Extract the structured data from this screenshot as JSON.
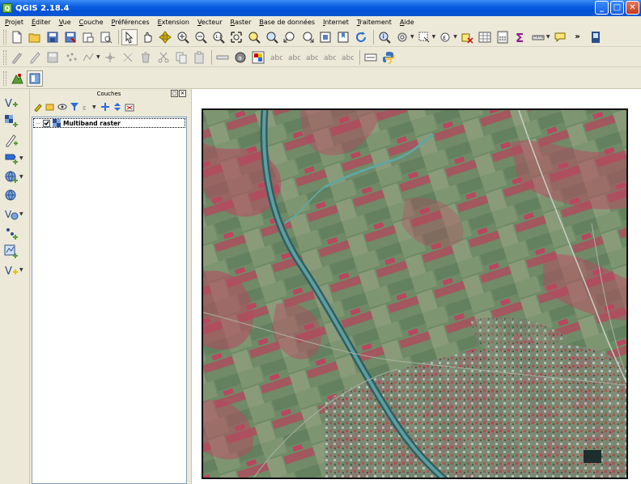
{
  "window": {
    "title": "QGIS 2.18.4",
    "app_letter": "Q",
    "minimize": "_",
    "maximize": "□",
    "close": "✕"
  },
  "menu": [
    {
      "u": "P",
      "rest": "rojet"
    },
    {
      "u": "É",
      "rest": "diter"
    },
    {
      "u": "V",
      "rest": "ue"
    },
    {
      "u": "C",
      "rest": "ouche"
    },
    {
      "u": "P",
      "rest": "références"
    },
    {
      "u": "E",
      "rest": "xtension"
    },
    {
      "u": "V",
      "rest": "ecteur"
    },
    {
      "u": "R",
      "rest": "aster"
    },
    {
      "u": "B",
      "rest": "ase de données"
    },
    {
      "u": "I",
      "rest": "nternet"
    },
    {
      "u": "T",
      "rest": "raitement"
    },
    {
      "u": "A",
      "rest": "ide"
    }
  ],
  "layers_panel": {
    "title": "Couches",
    "float_btn": "◻",
    "close_btn": "✕",
    "layers": [
      {
        "name": "Multiband raster",
        "visible": true,
        "expand": "—"
      }
    ]
  },
  "toolbar_more": "»",
  "colors": {
    "accent": "#0a5ee0",
    "raster_green": "#6f8a66",
    "raster_red": "#b8475f",
    "canal": "#3f7d80"
  }
}
